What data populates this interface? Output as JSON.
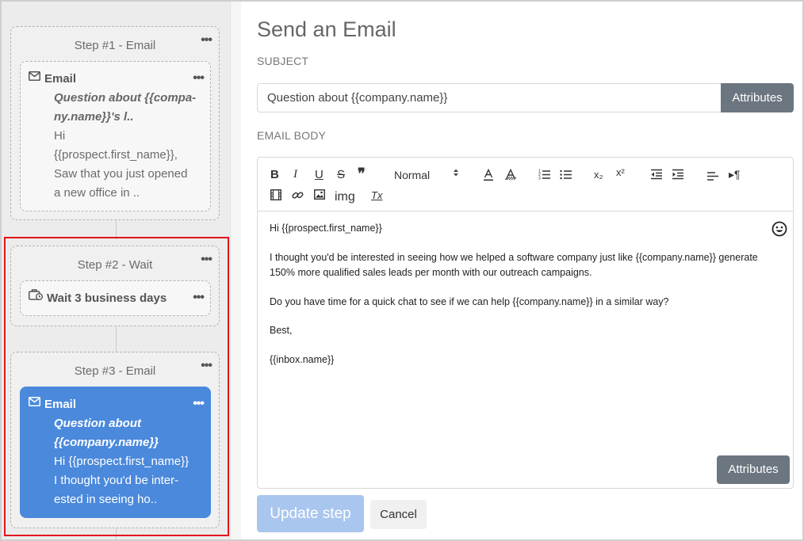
{
  "sequence": {
    "steps": [
      {
        "title": "Step #1 - Email",
        "card": {
          "type_label": "Email",
          "subject_lines": [
            "Question about {{compa-",
            "ny.name}}'s l.."
          ],
          "body_lines": [
            "Hi",
            "{{prospect.first_name}},",
            "Saw that you just opened",
            "a new office in .."
          ]
        }
      },
      {
        "title": "Step #2 - Wait",
        "card": {
          "type_label": "Wait 3 business days"
        }
      },
      {
        "title": "Step #3 - Email",
        "card": {
          "type_label": "Email",
          "subject_lines": [
            "Question about",
            "{{company.name}}"
          ],
          "body_lines": [
            "Hi {{prospect.first_name}}",
            "I thought you'd be inter-",
            "ested in seeing ho.."
          ]
        }
      }
    ],
    "menu_glyph": "•••"
  },
  "form": {
    "title": "Send an Email",
    "subject_label": "SUBJECT",
    "subject_value": "Question about {{company.name}}",
    "attributes_label": "Attributes",
    "body_label": "EMAIL BODY",
    "toolbar": {
      "bold": "B",
      "italic": "I",
      "underline": "U",
      "strike": "S",
      "quote": "❞",
      "header_select": "Normal",
      "subscript": "x₂",
      "superscript": "x²",
      "rtl": "▸¶",
      "image_text": "img",
      "clean": "Tx"
    },
    "body_lines": [
      "Hi {{prospect.first_name}}",
      "I thought you'd be interested in seeing how we helped a software company just like {{company.name}} generate",
      "150% more qualified sales leads per month with our outreach campaigns.",
      "Do you have time for a quick chat to see if we can help {{company.name}} in a similar way?",
      "Best,",
      "{{inbox.name}}"
    ],
    "update_label": "Update step",
    "cancel_label": "Cancel"
  },
  "colors": {
    "accent_blue": "#4a89dc",
    "attr_button": "#6c7680",
    "update_button": "#a9c6ee",
    "highlight_red": "#e4141b"
  }
}
